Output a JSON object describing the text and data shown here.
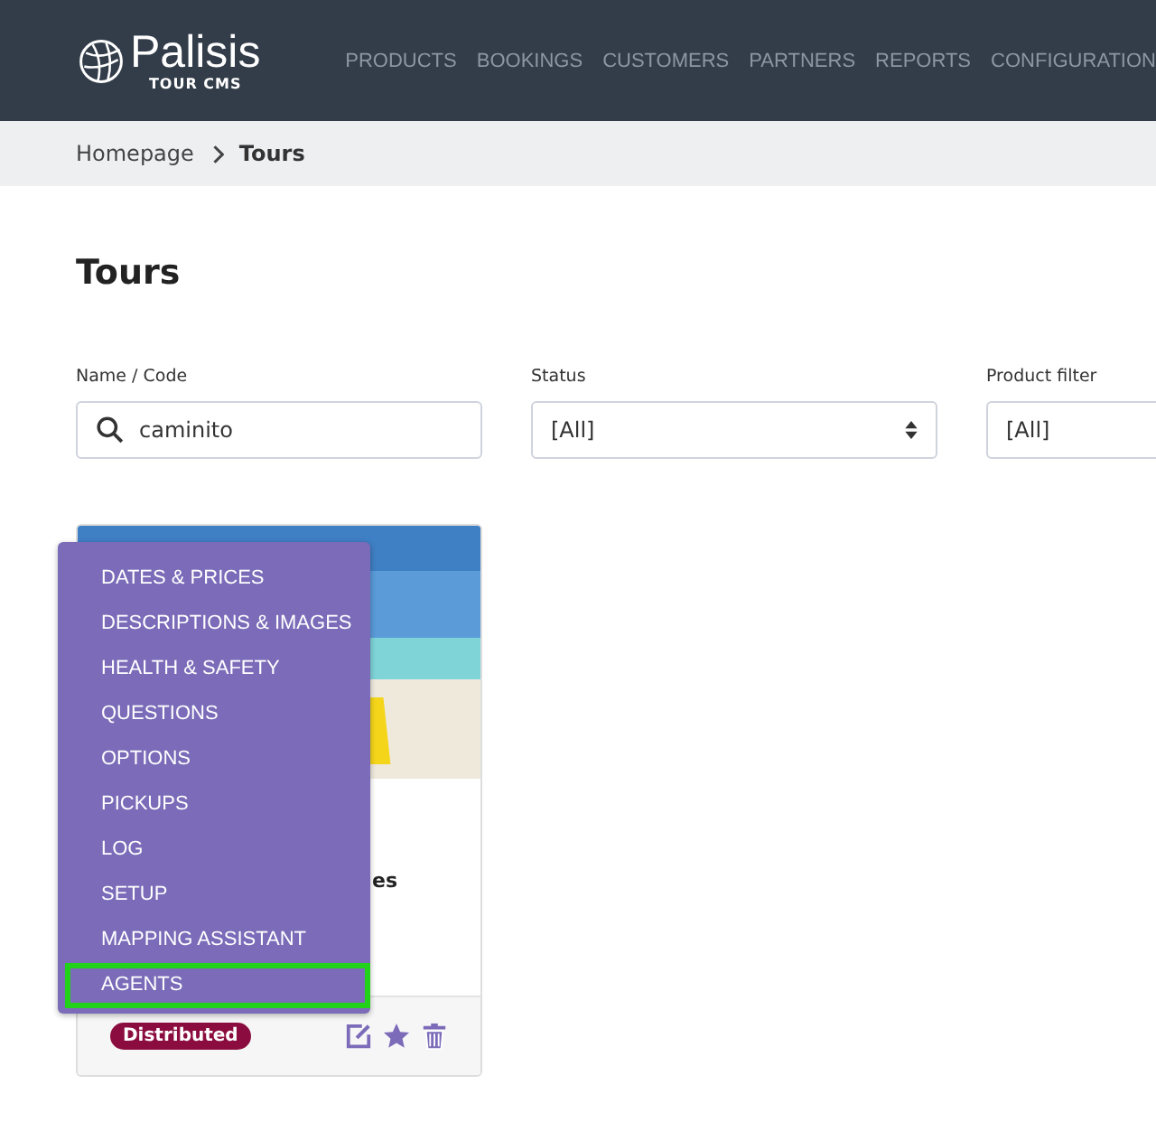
{
  "header": {
    "logo": "Palisis",
    "logo_sub": "TOUR CMS",
    "nav": [
      {
        "label": "PRODUCTS"
      },
      {
        "label": "BOOKINGS"
      },
      {
        "label": "CUSTOMERS"
      },
      {
        "label": "PARTNERS"
      },
      {
        "label": "REPORTS"
      },
      {
        "label": "CONFIGURATION"
      }
    ]
  },
  "breadcrumb": [
    {
      "label": "Homepage"
    },
    {
      "label": "Tours"
    }
  ],
  "title": "Tours",
  "filters": [
    {
      "kind": "search",
      "label": "Name / Code",
      "value": "caminito"
    },
    {
      "kind": "select",
      "label": "Status",
      "value": "[All]"
    },
    {
      "kind": "select_clipped",
      "label": "Product filter",
      "value": "[All]"
    }
  ],
  "card": {
    "title_fragment": "es",
    "badge": "Distributed"
  },
  "menu": [
    {
      "label": "DATES & PRICES",
      "selected": false
    },
    {
      "label": "DESCRIPTIONS & IMAGES",
      "selected": false
    },
    {
      "label": "HEALTH & SAFETY",
      "selected": false
    },
    {
      "label": "QUESTIONS",
      "selected": false
    },
    {
      "label": "OPTIONS",
      "selected": false
    },
    {
      "label": "PICKUPS",
      "selected": false
    },
    {
      "label": "LOG",
      "selected": false
    },
    {
      "label": "SETUP",
      "selected": false
    },
    {
      "label": "MAPPING ASSISTANT",
      "selected": false
    },
    {
      "label": "AGENTS",
      "selected": true
    }
  ]
}
